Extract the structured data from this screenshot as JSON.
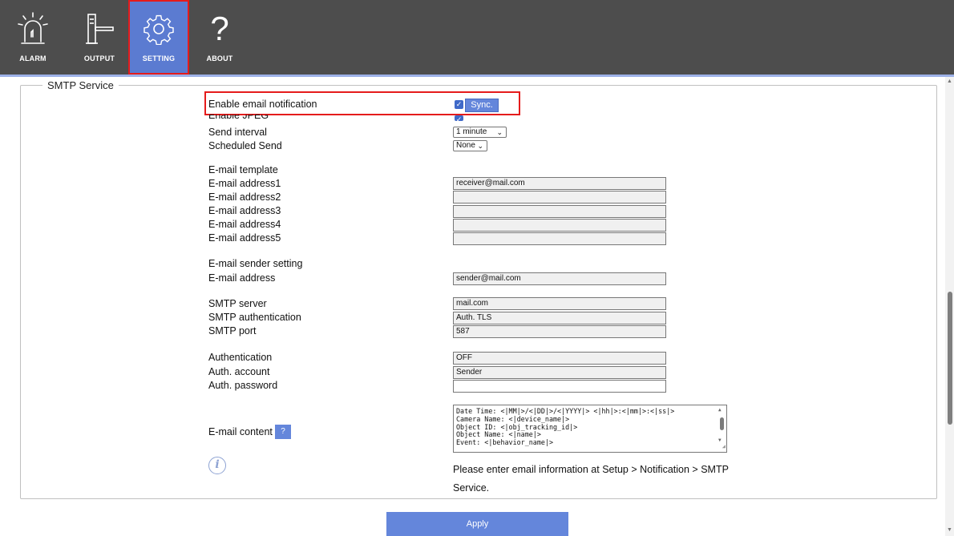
{
  "nav": {
    "items": [
      {
        "label": "ALARM",
        "icon": "alarm-light-icon"
      },
      {
        "label": "OUTPUT",
        "icon": "barrier-gate-icon"
      },
      {
        "label": "SETTING",
        "icon": "gear-icon",
        "active": true
      },
      {
        "label": "ABOUT",
        "icon": "question-mark-icon"
      }
    ],
    "about_glyph": "?"
  },
  "section": {
    "legend": "SMTP Service"
  },
  "form": {
    "enable_email": {
      "label": "Enable email notification",
      "checked": true,
      "sync_label": "Sync."
    },
    "enable_jpeg": {
      "label": "Enable JPEG",
      "checked": true
    },
    "send_interval": {
      "label": "Send interval",
      "value": "1 minute"
    },
    "scheduled_send": {
      "label": "Scheduled Send",
      "value": "None"
    },
    "template": {
      "label": "E-mail template"
    },
    "addresses": [
      {
        "label": "E-mail address1",
        "value": "receiver@mail.com"
      },
      {
        "label": "E-mail address2",
        "value": ""
      },
      {
        "label": "E-mail address3",
        "value": ""
      },
      {
        "label": "E-mail address4",
        "value": ""
      },
      {
        "label": "E-mail address5",
        "value": ""
      }
    ],
    "sender_setting": {
      "label": "E-mail sender setting"
    },
    "sender_address": {
      "label": "E-mail address",
      "value": "sender@mail.com"
    },
    "smtp_server": {
      "label": "SMTP server",
      "value": "mail.com"
    },
    "smtp_auth": {
      "label": "SMTP authentication",
      "value": "Auth. TLS"
    },
    "smtp_port": {
      "label": "SMTP port",
      "value": "587"
    },
    "authentication": {
      "label": "Authentication",
      "value": "OFF"
    },
    "auth_account": {
      "label": "Auth. account",
      "value": "Sender"
    },
    "auth_password": {
      "label": "Auth. password",
      "value": ""
    },
    "content": {
      "label": "E-mail content",
      "help_label": "?",
      "lines": [
        "Date Time: <|MM|>/<|DD|>/<|YYYY|> <|hh|>:<|mm|>:<|ss|>",
        "Camera Name: <|device_name|>",
        "Object ID: <|obj_tracking_id|>",
        "Object Name: <|name|>",
        "Event: <|behavior_name|>"
      ]
    }
  },
  "info": {
    "icon": "info-icon",
    "text": "Please enter email information at Setup > Notification > SMTP Service."
  },
  "apply_label": "Apply",
  "colors": {
    "topbar": "#4d4d4d",
    "accent": "#6486db",
    "highlight": "#e51b1b"
  }
}
